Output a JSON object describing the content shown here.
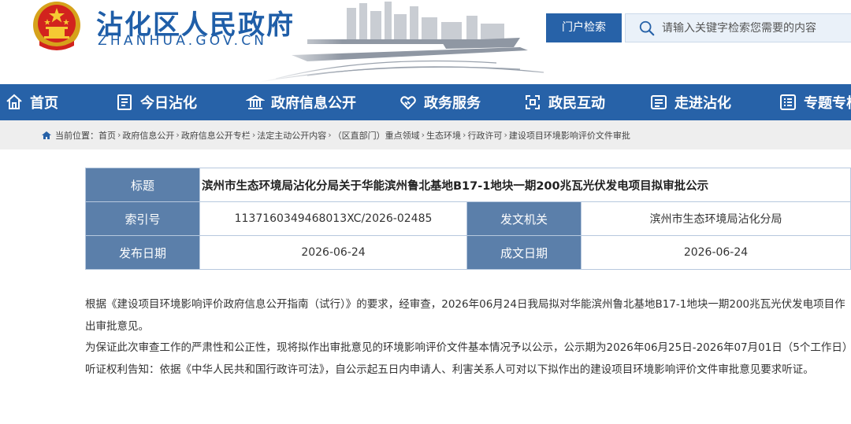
{
  "header": {
    "site_title": "沾化区人民政府",
    "site_domain": "ZHANHUA.GOV.CN",
    "portal_search_label": "门户检索",
    "search_placeholder": "请输入关键字检索您需要的内容"
  },
  "nav": {
    "items": [
      {
        "label": "首页",
        "icon": "home-icon"
      },
      {
        "label": "今日沾化",
        "icon": "document-icon"
      },
      {
        "label": "政府信息公开",
        "icon": "government-building-icon"
      },
      {
        "label": "政务服务",
        "icon": "handshake-icon"
      },
      {
        "label": "政民互动",
        "icon": "interaction-icon"
      },
      {
        "label": "走进沾化",
        "icon": "info-card-icon"
      },
      {
        "label": "专题专栏",
        "icon": "list-icon"
      }
    ]
  },
  "breadcrumb": {
    "prefix": "当前位置：",
    "items": [
      "首页",
      "政府信息公开",
      "政府信息公开专栏",
      "法定主动公开内容",
      "（区直部门）重点领域",
      "生态环境",
      "行政许可",
      "建设项目环境影响评价文件审批"
    ],
    "separator": "›"
  },
  "info": {
    "title_label": "标题",
    "title_value": "滨州市生态环境局沾化分局关于华能滨州鲁北基地B17-1地块一期200兆瓦光伏发电项目拟审批公示",
    "index_label": "索引号",
    "index_value": "113716034946801​3XC/2026-02485",
    "issuer_label": "发文机关",
    "issuer_value": "滨州市生态环境局沾化分局",
    "publish_label": "发布日期",
    "publish_value": "2026-06-24",
    "written_label": "成文日期",
    "written_value": "2026-06-24"
  },
  "article": {
    "paragraphs": [
      "根据《建设项目环境影响评价政府信息公开指南（试行）》的要求，经审查，2026年06月24日我局拟对华能滨州鲁北基地B17-1地块一期200兆瓦光伏发电项目作出审批意见。",
      "为保证此次审查工作的严肃性和公正性，现将拟作出审批意见的环境影响评价文件基本情况予以公示，公示期为2026年06月25日-2026年07月01日（5个工作日）",
      "听证权利告知：依据《中华人民共和国行政许可法》，自公示起五日内申请人、利害关系人可对以下拟作出的建设项目环境影响评价文件审批意见要求听证。"
    ]
  },
  "colors": {
    "brand_blue": "#2762a8",
    "label_blue": "#5b7faa",
    "breadcrumb_bg": "#eeeeee"
  }
}
